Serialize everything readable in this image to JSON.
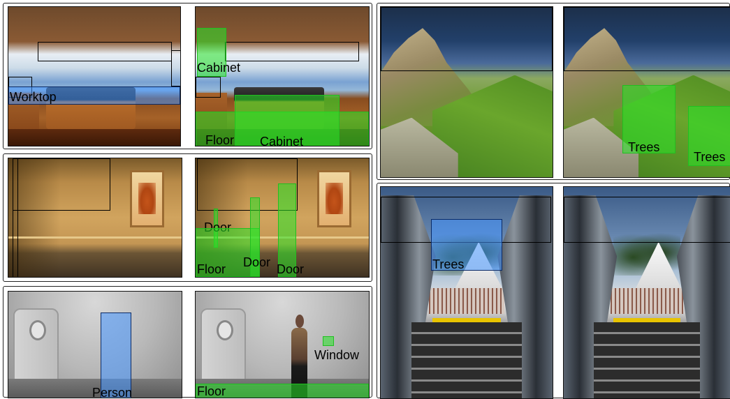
{
  "colors": {
    "gt_box": "#20c020",
    "pred_box": "#4696ff",
    "outline": "#000000"
  },
  "labels": {
    "worktop": "Worktop",
    "cabinet_top": "Cabinet",
    "floor_kitchen": "Floor",
    "cabinet_island": "Cabinet",
    "door_a": "Door",
    "floor_hall": "Floor",
    "door_b": "Door",
    "door_c": "Door",
    "person": "Person",
    "window": "Window",
    "floor_room": "Floor",
    "trees_a": "Trees",
    "trees_b": "Trees",
    "trees_escalator": "Trees"
  }
}
